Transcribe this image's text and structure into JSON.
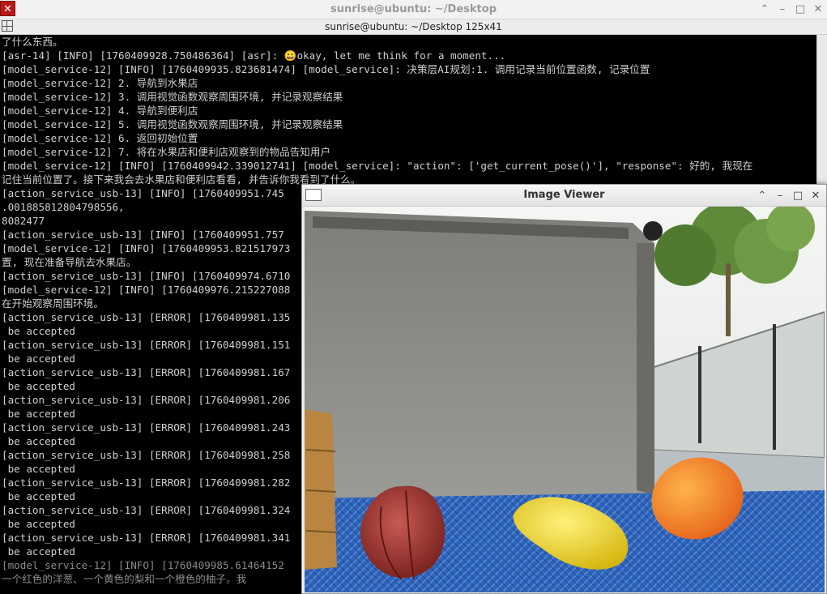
{
  "terminal": {
    "title": "sunrise@ubuntu: ~/Desktop",
    "subtitle": "sunrise@ubuntu: ~/Desktop 125x41",
    "controls": {
      "keep_above": "⌃",
      "minimize": "–",
      "maximize": "□",
      "close": "✕"
    },
    "lines": [
      "了什么东西。",
      "[asr-14] [INFO] [1760409928.750486364] [asr]: 😀okay, let me think for a moment...",
      "[model_service-12] [INFO] [1760409935.823681474] [model_service]: 决策层AI规划:1. 调用记录当前位置函数, 记录位置",
      "[model_service-12] 2. 导航到水果店",
      "[model_service-12] 3. 调用视觉函数观察周围环境, 并记录观察结果",
      "[model_service-12] 4. 导航到便利店",
      "[model_service-12] 5. 调用视觉函数观察周围环境, 并记录观察结果",
      "[model_service-12] 6. 返回初始位置",
      "[model_service-12] 7. 将在水果店和便利店观察到的物品告知用户",
      "[model_service-12] [INFO] [1760409942.339012741] [model_service]: \"action\": ['get_current_pose()'], \"response\": 好的, 我现在",
      "记住当前位置了。接下来我会去水果店和便利店看看, 并告诉你我看到了什么。",
      "[action_service_usb-13] [INFO] [1760409951.745",
      ".001885812804798556,",
      "8082477",
      "[action_service_usb-13] [INFO] [1760409951.757",
      "[model_service-12] [INFO] [1760409953.821517973",
      "置, 现在准备导航去水果店。",
      "[action_service_usb-13] [INFO] [1760409974.6710",
      "[model_service-12] [INFO] [1760409976.215227088",
      "在开始观察周围环境。",
      "[action_service_usb-13] [ERROR] [1760409981.135",
      " be accepted",
      "[action_service_usb-13] [ERROR] [1760409981.151",
      " be accepted",
      "[action_service_usb-13] [ERROR] [1760409981.167",
      " be accepted",
      "[action_service_usb-13] [ERROR] [1760409981.206",
      " be accepted",
      "[action_service_usb-13] [ERROR] [1760409981.243",
      " be accepted",
      "[action_service_usb-13] [ERROR] [1760409981.258",
      " be accepted",
      "[action_service_usb-13] [ERROR] [1760409981.282",
      " be accepted",
      "[action_service_usb-13] [ERROR] [1760409981.324",
      " be accepted",
      "[action_service_usb-13] [ERROR] [1760409981.341",
      " be accepted",
      "[model_service-12] [INFO] [1760409985.61464152",
      "一个红色的洋葱、一个黄色的梨和一个橙色的柚子。我"
    ]
  },
  "viewer": {
    "title": "Image Viewer",
    "controls": {
      "keep_above": "⌃",
      "minimize": "–",
      "maximize": "□",
      "close": "✕"
    }
  },
  "colors": {
    "terminal_bg": "#000000",
    "terminal_text": "#cfcfcf",
    "app_icon": "#b81919"
  }
}
